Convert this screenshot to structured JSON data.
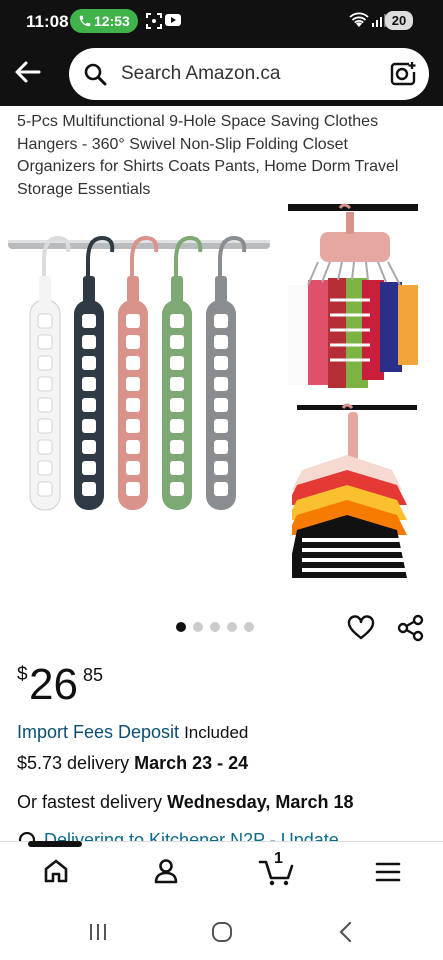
{
  "status_bar": {
    "time": "11:08",
    "call_timer": "12:53",
    "battery": "20"
  },
  "search": {
    "placeholder": "Search Amazon.ca"
  },
  "product": {
    "title": "5-Pcs Multifunctional 9-Hole Space Saving Clothes Hangers - 360° Swivel Non-Slip Folding Closet Organizers for Shirts Coats Pants, Home Dorm Travel Storage Essentials",
    "image_count": 5,
    "active_image": 1,
    "hanger_colors": [
      "#f4f4f4",
      "#2f3a45",
      "#d9938a",
      "#7ea874",
      "#8a8d90"
    ]
  },
  "price": {
    "symbol": "$",
    "whole": "26",
    "fraction": "85"
  },
  "import": {
    "link": "Import Fees Deposit",
    "suffix": "Included"
  },
  "delivery": {
    "cost": "$5.73 delivery",
    "dates": "March 23 - 24"
  },
  "fastest": {
    "prefix": "Or fastest delivery",
    "date": "Wednesday, March 18"
  },
  "deliver_to": {
    "text": "Delivering to Kitchener N2P - Update"
  },
  "nav": {
    "cart_count": "1"
  }
}
